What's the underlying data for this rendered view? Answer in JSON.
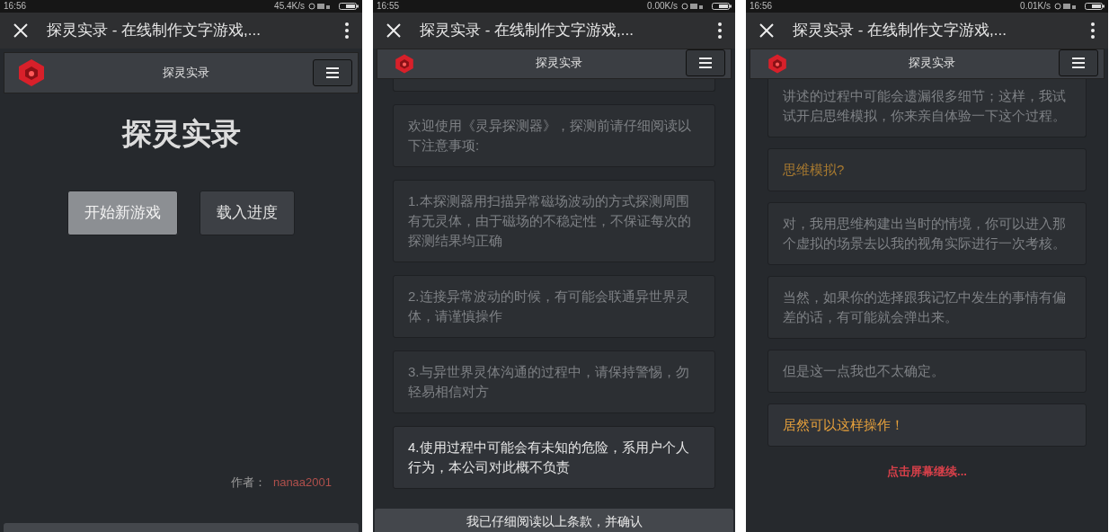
{
  "screens": [
    {
      "kind": "menu",
      "status_bar": {
        "time": "16:56",
        "speed": "45.4K/s"
      },
      "browser": {
        "title": "探灵实录 - 在线制作文字游戏,..."
      },
      "header": {
        "title": "探灵实录"
      },
      "game_title": "探灵实录",
      "buttons": [
        {
          "label": "开始新游戏",
          "highlighted": true
        },
        {
          "label": "载入进度",
          "highlighted": false
        }
      ],
      "author": {
        "label": "作者：",
        "name": "nanaa2001"
      }
    },
    {
      "kind": "terms",
      "status_bar": {
        "time": "16:55",
        "speed": "0.00K/s"
      },
      "browser": {
        "title": "探灵实录 - 在线制作文字游戏,..."
      },
      "header": {
        "title": "探灵实录"
      },
      "messages": [
        {
          "kind": "npc",
          "current": false,
          "text": "欢迎使用《灵异探测器》，探测前请仔细阅读以下注意事项:"
        },
        {
          "kind": "npc",
          "current": false,
          "text": "1.本探测器用扫描异常磁场波动的方式探测周围有无灵体，由于磁场的不稳定性，不保证每次的探测结果均正确"
        },
        {
          "kind": "npc",
          "current": false,
          "text": "2.连接异常波动的时候，有可能会联通异世界灵体，请谨慎操作"
        },
        {
          "kind": "npc",
          "current": false,
          "text": "3.与异世界灵体沟通的过程中，请保持警惕，勿轻易相信对方"
        },
        {
          "kind": "npc",
          "current": true,
          "text": "4.使用过程中可能会有未知的危险，系用户个人行为，本公司对此概不负责"
        }
      ],
      "confirm_button": "我已仔细阅读以上条款，并确认"
    },
    {
      "kind": "story",
      "status_bar": {
        "time": "16:56",
        "speed": "0.01K/s"
      },
      "browser": {
        "title": "探灵实录 - 在线制作文字游戏,..."
      },
      "header": {
        "title": "探灵实录"
      },
      "messages": [
        {
          "kind": "npc",
          "current": false,
          "text": "讲述的过程中可能会遗漏很多细节；这样，我试试开启思维模拟，你来亲自体验一下这个过程。"
        },
        {
          "kind": "player",
          "current": false,
          "text": "思维模拟?"
        },
        {
          "kind": "npc",
          "current": false,
          "text": "对，我用思维构建出当时的情境，你可以进入那个虚拟的场景去以我的视角实际进行一次考核。"
        },
        {
          "kind": "npc",
          "current": false,
          "text": "当然，如果你的选择跟我记忆中发生的事情有偏差的话，有可能就会弹出来。"
        },
        {
          "kind": "npc",
          "current": false,
          "text": "但是这一点我也不太确定。"
        },
        {
          "kind": "player",
          "current": true,
          "text": "居然可以这样操作！"
        }
      ],
      "continue_hint": "点击屏幕继续..."
    }
  ]
}
